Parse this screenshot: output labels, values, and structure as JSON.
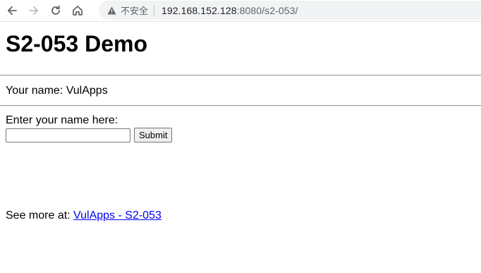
{
  "browser": {
    "security_label": "不安全",
    "url_host": "192.168.152.128",
    "url_rest": ":8080/s2-053/"
  },
  "page": {
    "title": "S2-053 Demo",
    "name_line": "Your name: VulApps",
    "form_label": "Enter your name here:",
    "input_value": "",
    "input_placeholder": "",
    "submit_label": "Submit",
    "see_more_prefix": "See more at: ",
    "see_more_link": "VulApps - S2-053"
  }
}
